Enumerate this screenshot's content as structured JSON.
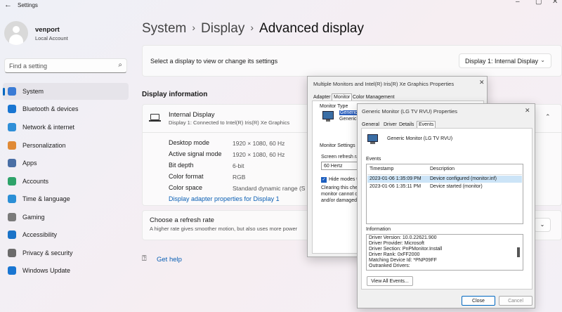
{
  "window": {
    "title": "Settings"
  },
  "user": {
    "name": "venport",
    "account": "Local Account"
  },
  "search": {
    "placeholder": "Find a setting"
  },
  "nav": [
    {
      "label": "System",
      "color": "#3a7bd5"
    },
    {
      "label": "Bluetooth & devices",
      "color": "#1976d2"
    },
    {
      "label": "Network & internet",
      "color": "#2f8fd8"
    },
    {
      "label": "Personalization",
      "color": "#e08a36"
    },
    {
      "label": "Apps",
      "color": "#4a6fa5"
    },
    {
      "label": "Accounts",
      "color": "#2ea36a"
    },
    {
      "label": "Time & language",
      "color": "#2b8fd6"
    },
    {
      "label": "Gaming",
      "color": "#7a7a7a"
    },
    {
      "label": "Accessibility",
      "color": "#1a73c8"
    },
    {
      "label": "Privacy & security",
      "color": "#6b6b6b"
    },
    {
      "label": "Windows Update",
      "color": "#1976d2"
    }
  ],
  "breadcrumb": {
    "part1": "System",
    "part2": "Display",
    "current": "Advanced display"
  },
  "select_display": {
    "label": "Select a display to view or change its settings",
    "value": "Display 1: Internal Display"
  },
  "display_info": {
    "heading": "Display information",
    "name": "Internal Display",
    "subtitle": "Display 1: Connected to Intel(R) Iris(R) Xe Graphics",
    "rows": [
      {
        "label": "Desktop mode",
        "value": "1920 × 1080, 60 Hz"
      },
      {
        "label": "Active signal mode",
        "value": "1920 × 1080, 60 Hz"
      },
      {
        "label": "Bit depth",
        "value": "6-bit"
      },
      {
        "label": "Color format",
        "value": "RGB"
      },
      {
        "label": "Color space",
        "value": "Standard dynamic range (S"
      }
    ],
    "adapter_link": "Display adapter properties for Display 1"
  },
  "refresh": {
    "title": "Choose a refresh rate",
    "desc": "A higher rate gives smoother motion, but also uses more power"
  },
  "help": {
    "label": "Get help"
  },
  "dialog1": {
    "title": "Multiple Monitors and Intel(R) Iris(R) Xe Graphics Properties",
    "tabs": [
      "Adapter",
      "Monitor",
      "Color Management"
    ],
    "monitor_type_label": "Monitor Type",
    "monitor_type_line1": "Generic",
    "monitor_type_line2": "Generic",
    "monitor_settings_label": "Monitor Settings",
    "refresh_label": "Screen refresh ra",
    "refresh_value": "60 Hertz",
    "hide_modes": "Hide modes th",
    "clearing_text": [
      "Clearing this chec",
      "monitor cannot d",
      "and/or damaged"
    ]
  },
  "dialog2": {
    "title": "Generic Monitor (LG TV RVU) Properties",
    "tabs": [
      "General",
      "Driver",
      "Details",
      "Events"
    ],
    "device_name": "Generic Monitor (LG TV RVU)",
    "events_label": "Events",
    "columns": [
      "Timestamp",
      "Description"
    ],
    "events": [
      {
        "timestamp": "2023-01-06 1:35:09 PM",
        "description": "Device configured (monitor.inf)"
      },
      {
        "timestamp": "2023-01-06 1:35:11 PM",
        "description": "Device started (monitor)"
      }
    ],
    "info_label": "Information",
    "info_lines": [
      "Driver Version: 10.0.22621.900",
      "Driver Provider: Microsoft",
      "Driver Section: PnPMonitor.Install",
      "Driver Rank: 0xFF2000",
      "Matching Device Id: *PNP09FF",
      "Outranked Drivers:"
    ],
    "view_all": "View All Events...",
    "close": "Close",
    "cancel": "Cancel"
  }
}
